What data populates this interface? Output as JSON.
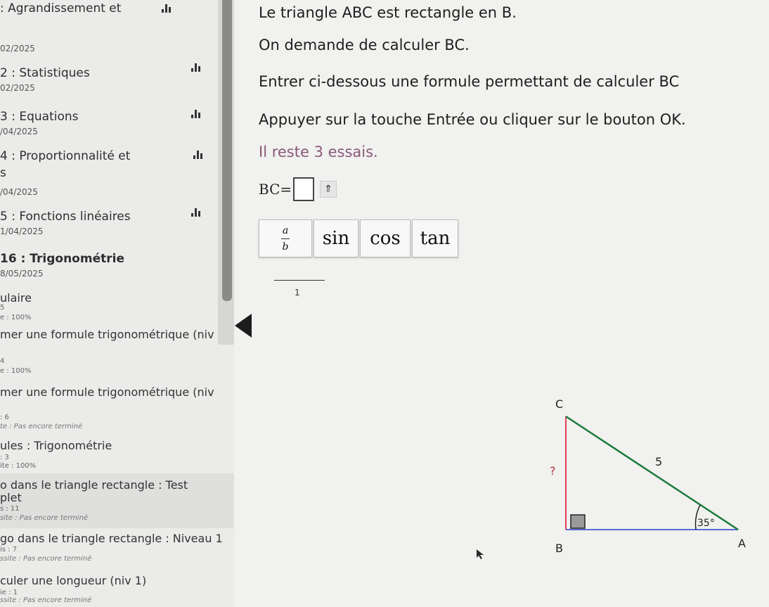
{
  "sidebar": {
    "chapters": [
      {
        "title": ": Agrandissement et",
        "date": ""
      },
      {
        "title": "",
        "date": "02/2025"
      },
      {
        "title": "2 : Statistiques",
        "date": "02/2025"
      },
      {
        "title": "3 : Equations",
        "date": "/04/2025"
      },
      {
        "title": "4 : Proportionnalité et",
        "title2": "s",
        "date": "/04/2025"
      },
      {
        "title": "5 : Fonctions linéaires",
        "date": "1/04/2025"
      },
      {
        "title": "16 : Trigonométrie",
        "date": "8/05/2025"
      }
    ],
    "exercises": [
      {
        "title": "ulaire",
        "count": "5",
        "status": "e : 100%"
      },
      {
        "title": "mer une formule trigonométrique (niv",
        "count": "4",
        "status": "e : 100%"
      },
      {
        "title": "mer une formule trigonométrique (niv",
        "count": ": 6",
        "status": "te : Pas encore terminé"
      },
      {
        "title": "ules : Trigonométrie",
        "count": ": 3",
        "status": "ite : 100%"
      },
      {
        "title": "o dans le triangle rectangle : Test",
        "title2": "plet",
        "count": "s : 11",
        "status": "site : Pas encore terminé"
      },
      {
        "title": "go dans le triangle rectangle : Niveau 1",
        "count": "is : 7",
        "status": "ssite : Pas encore terminé"
      },
      {
        "title": "culer une longueur (niv 1)",
        "count": "ie : 1",
        "status": "ssite : Pas encore terminé"
      }
    ]
  },
  "main": {
    "line1": "Le triangle ABC est rectangle en B.",
    "line2": "On demande de calculer BC.",
    "line3": "Entrer ci-dessous une formule permettant de calculer BC",
    "line4": "Appuyer sur la touche Entrée ou cliquer sur le bouton OK.",
    "line5": "Il reste 3 essais.",
    "bc_label": "BC=",
    "sqrt_symbol": "⇑",
    "toolbar": {
      "frac_num": "a",
      "frac_den": "b",
      "sin": "sin",
      "cos": "cos",
      "tan": "tan"
    },
    "slider_value": "1"
  },
  "figure": {
    "C": "C",
    "B": "B",
    "A": "A",
    "unknown": "?",
    "hyp": "5",
    "angle": "35°"
  },
  "colors": {
    "leg_vertical": "#e0405a",
    "leg_horizontal": "#5a6ad8",
    "hypotenuse": "#1a7a3a"
  }
}
